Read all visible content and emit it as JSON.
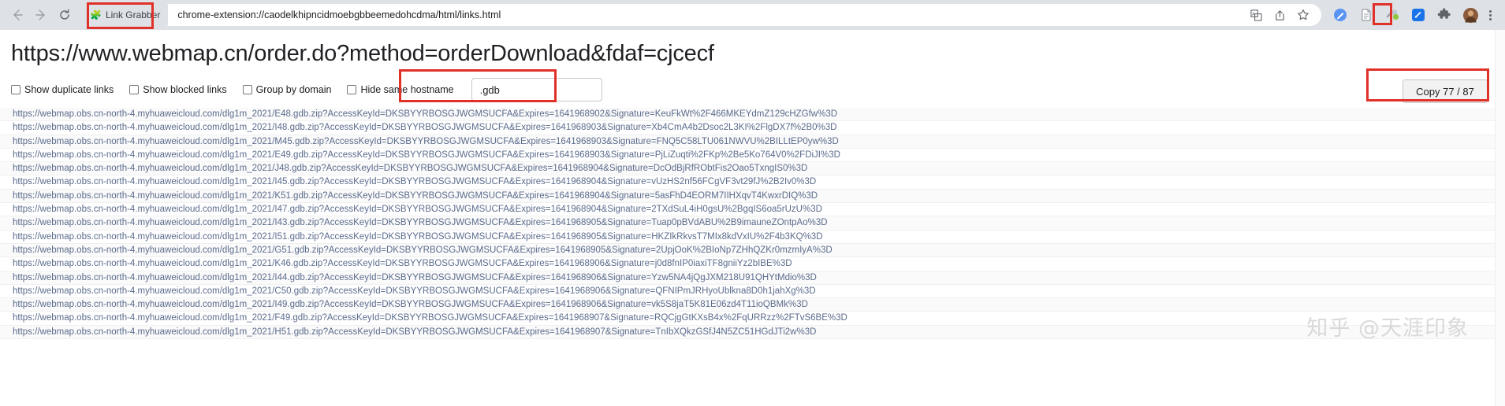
{
  "browser": {
    "back_icon": "back-arrow-icon",
    "forward_icon": "forward-arrow-icon",
    "reload_icon": "reload-icon",
    "extension_chip_label": "Link Grabber",
    "extension_chip_icon": "puzzle-piece-icon",
    "url": "chrome-extension://caodelkhipncidmoebgbbeemedohcdma/html/links.html",
    "omnibox_icons": [
      "translate-icon",
      "share-icon",
      "bookmark-star-icon"
    ],
    "toolbar_extension_icons": [
      "pen-badge-icon",
      "reader-page-icon",
      "link-grabber-icon",
      "pocket-blue-icon",
      "extensions-puzzle-icon",
      "profile-avatar-icon"
    ],
    "menu_icon": "three-dot-menu-icon"
  },
  "page": {
    "title": "https://www.webmap.cn/order.do?method=orderDownload&fdaf=cjcecf",
    "checkboxes": [
      {
        "label": "Show duplicate links",
        "checked": false
      },
      {
        "label": "Show blocked links",
        "checked": false
      },
      {
        "label": "Group by domain",
        "checked": false
      },
      {
        "label": "Hide same hostname",
        "checked": false
      }
    ],
    "filter": {
      "value": ".gdb",
      "placeholder": ""
    },
    "copy_button_label": "Copy 77 / 87",
    "watermark": "知乎 @天涯印象"
  },
  "links": [
    "https://webmap.obs.cn-north-4.myhuaweicloud.com/dlg1m_2021/E48.gdb.zip?AccessKeyId=DKSBYYRBOSGJWGMSUCFA&Expires=1641968902&Signature=KeuFkWt%2F466MKEYdmZ129cHZGfw%3D",
    "https://webmap.obs.cn-north-4.myhuaweicloud.com/dlg1m_2021/I48.gdb.zip?AccessKeyId=DKSBYYRBOSGJWGMSUCFA&Expires=1641968903&Signature=Xb4CmA4b2Dsoc2L3KI%2FlgDX7f%2B0%3D",
    "https://webmap.obs.cn-north-4.myhuaweicloud.com/dlg1m_2021/M45.gdb.zip?AccessKeyId=DKSBYYRBOSGJWGMSUCFA&Expires=1641968903&Signature=FNQ5C58LTU061NWVU%2BILLtEP0yw%3D",
    "https://webmap.obs.cn-north-4.myhuaweicloud.com/dlg1m_2021/E49.gdb.zip?AccessKeyId=DKSBYYRBOSGJWGMSUCFA&Expires=1641968903&Signature=PjLiZuqti%2FKp%2Be5Ko764V0%2FDiJI%3D",
    "https://webmap.obs.cn-north-4.myhuaweicloud.com/dlg1m_2021/J48.gdb.zip?AccessKeyId=DKSBYYRBOSGJWGMSUCFA&Expires=1641968904&Signature=DcOdBjRfRObtFis2Oao5TxngIS0%3D",
    "https://webmap.obs.cn-north-4.myhuaweicloud.com/dlg1m_2021/I45.gdb.zip?AccessKeyId=DKSBYYRBOSGJWGMSUCFA&Expires=1641968904&Signature=vUzHS2nf56FCgVF3vt29fJ%2B2Iv0%3D",
    "https://webmap.obs.cn-north-4.myhuaweicloud.com/dlg1m_2021/K51.gdb.zip?AccessKeyId=DKSBYYRBOSGJWGMSUCFA&Expires=1641968904&Signature=5asFhD4EORM7IIHXqvT4KwxrDIQ%3D",
    "https://webmap.obs.cn-north-4.myhuaweicloud.com/dlg1m_2021/I47.gdb.zip?AccessKeyId=DKSBYYRBOSGJWGMSUCFA&Expires=1641968904&Signature=2TXdSuL4iH0gsU%2BgqIS6oa5rUzU%3D",
    "https://webmap.obs.cn-north-4.myhuaweicloud.com/dlg1m_2021/I43.gdb.zip?AccessKeyId=DKSBYYRBOSGJWGMSUCFA&Expires=1641968905&Signature=Tuap0pBVdABU%2B9imauneZOntpAo%3D",
    "https://webmap.obs.cn-north-4.myhuaweicloud.com/dlg1m_2021/I51.gdb.zip?AccessKeyId=DKSBYYRBOSGJWGMSUCFA&Expires=1641968905&Signature=HKZIkRkvsT7MIx8kdVxIU%2F4b3KQ%3D",
    "https://webmap.obs.cn-north-4.myhuaweicloud.com/dlg1m_2021/G51.gdb.zip?AccessKeyId=DKSBYYRBOSGJWGMSUCFA&Expires=1641968905&Signature=2UpjOoK%2BIoNp7ZHhQZKr0mzmIyA%3D",
    "https://webmap.obs.cn-north-4.myhuaweicloud.com/dlg1m_2021/K46.gdb.zip?AccessKeyId=DKSBYYRBOSGJWGMSUCFA&Expires=1641968906&Signature=j0d8fnIP0iaxiTF8gniiYz2bIBE%3D",
    "https://webmap.obs.cn-north-4.myhuaweicloud.com/dlg1m_2021/I44.gdb.zip?AccessKeyId=DKSBYYRBOSGJWGMSUCFA&Expires=1641968906&Signature=Yzw5NA4jQgJXM218U91QHYtMdio%3D",
    "https://webmap.obs.cn-north-4.myhuaweicloud.com/dlg1m_2021/C50.gdb.zip?AccessKeyId=DKSBYYRBOSGJWGMSUCFA&Expires=1641968906&Signature=QFNIPmJRHyoUblkna8D0h1jahXg%3D",
    "https://webmap.obs.cn-north-4.myhuaweicloud.com/dlg1m_2021/I49.gdb.zip?AccessKeyId=DKSBYYRBOSGJWGMSUCFA&Expires=1641968906&Signature=vk5S8jaT5K81E06zd4T11ioQBMk%3D",
    "https://webmap.obs.cn-north-4.myhuaweicloud.com/dlg1m_2021/F49.gdb.zip?AccessKeyId=DKSBYYRBOSGJWGMSUCFA&Expires=1641968907&Signature=RQCjgGtKXsB4x%2FqURRzz%2FTvS6BE%3D",
    "https://webmap.obs.cn-north-4.myhuaweicloud.com/dlg1m_2021/H51.gdb.zip?AccessKeyId=DKSBYYRBOSGJWGMSUCFA&Expires=1641968907&Signature=TnIbXQkzGSfJ4N5ZC51HGdJTi2w%3D"
  ]
}
